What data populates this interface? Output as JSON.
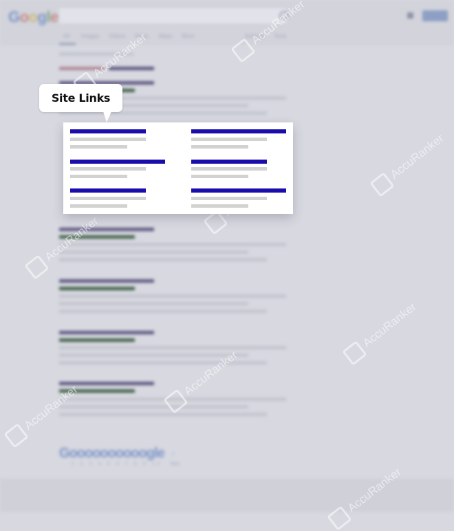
{
  "logo_letters": [
    {
      "ch": "G",
      "color": "#7e96c8"
    },
    {
      "ch": "o",
      "color": "#c48a8a"
    },
    {
      "ch": "o",
      "color": "#cdbb7c"
    },
    {
      "ch": "g",
      "color": "#7e96c8"
    },
    {
      "ch": "l",
      "color": "#7fa883"
    },
    {
      "ch": "e",
      "color": "#c48a8a"
    }
  ],
  "header": {
    "tabs": [
      "All",
      "Images",
      "Videos",
      "News",
      "Maps",
      "More",
      "Settings",
      "Tools"
    ]
  },
  "callout": {
    "label": "Site Links"
  },
  "pagination": {
    "logo_text": "Goooooooooogle",
    "pages": "1 2 3 4 5 6 7 8 9 10",
    "next_arrow": "›",
    "next_label": "Next"
  },
  "watermark": {
    "text": "AccuRanker"
  },
  "colors": {
    "sitelink_title": "#1a0dab",
    "sitelink_snippet": "#d2d2d2",
    "callout_bg": "#ffffff",
    "page_bg": "#d7d8e0"
  }
}
